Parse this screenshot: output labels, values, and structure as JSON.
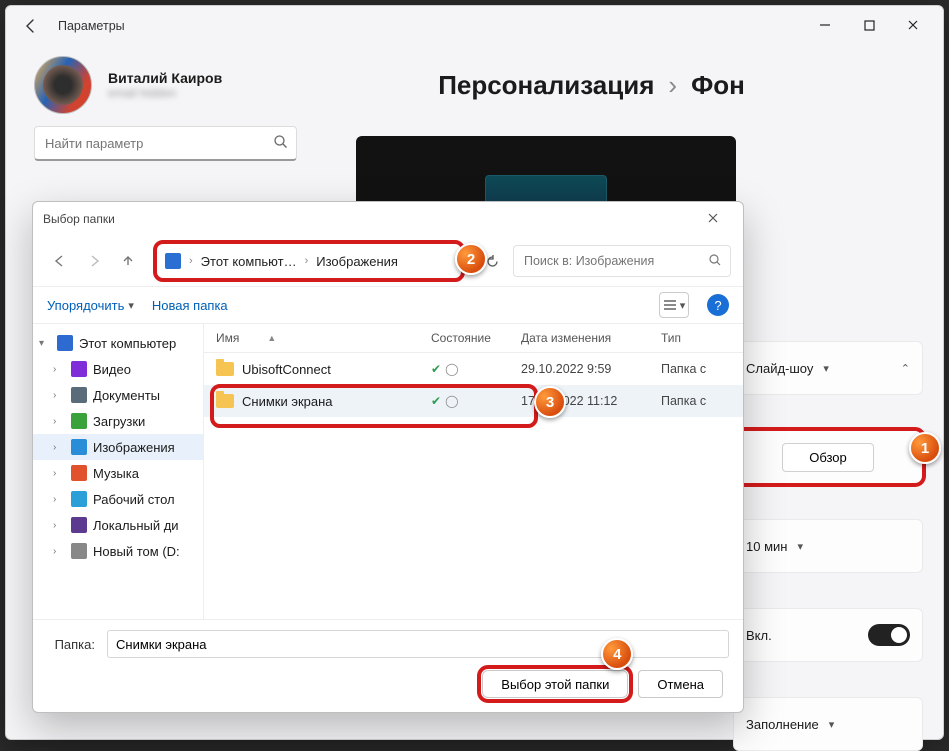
{
  "titlebar": {
    "app": "Параметры"
  },
  "profile": {
    "name": "Виталий Каиров",
    "email": "email hidden"
  },
  "breadcrumb": {
    "section": "Персонализация",
    "page": "Фон"
  },
  "search": {
    "placeholder": "Найти параметр"
  },
  "settings": {
    "mode_value": "Слайд-шоу",
    "browse_label": "Обзор",
    "interval_value": "10 мин",
    "toggle_label": "Вкл.",
    "fit_value": "Заполнение"
  },
  "dialog": {
    "title": "Выбор папки",
    "crumbs": {
      "root": "Этот компьют…",
      "leaf": "Изображения"
    },
    "search_placeholder": "Поиск в: Изображения",
    "toolbar": {
      "organize": "Упорядочить",
      "new_folder": "Новая папка"
    },
    "columns": {
      "name": "Имя",
      "state": "Состояние",
      "date": "Дата изменения",
      "type": "Тип"
    },
    "rows": [
      {
        "name": "UbisoftConnect",
        "date": "29.10.2022 9:59",
        "type": "Папка с"
      },
      {
        "name": "Снимки экрана",
        "date": "17.12.2022 11:12",
        "type": "Папка с"
      }
    ],
    "tree": [
      "Этот компьютер",
      "Видео",
      "Документы",
      "Загрузки",
      "Изображения",
      "Музыка",
      "Рабочий стол",
      "Локальный ди",
      "Новый том (D:"
    ],
    "footer": {
      "label": "Папка:",
      "value": "Снимки экрана",
      "choose": "Выбор этой папки",
      "cancel": "Отмена"
    }
  },
  "callouts": {
    "c1": "1",
    "c2": "2",
    "c3": "3",
    "c4": "4"
  }
}
